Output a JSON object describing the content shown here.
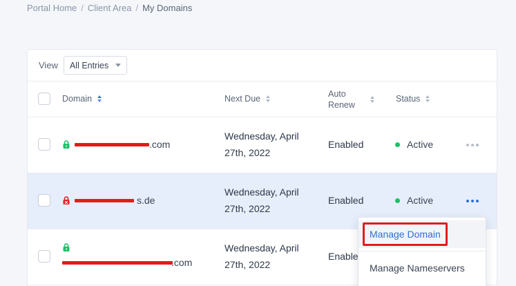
{
  "breadcrumb": {
    "items": [
      "Portal Home",
      "Client Area",
      "My Domains"
    ],
    "separator": "/"
  },
  "toolbar": {
    "view_label": "View",
    "view_select_value": "All Entries"
  },
  "table": {
    "headers": {
      "domain": "Domain",
      "next_due": "Next Due",
      "auto_renew_line1": "Auto",
      "auto_renew_line2": "Renew",
      "status": "Status"
    },
    "rows": [
      {
        "domain_visible_suffix": ".com",
        "lock_color": "#1fbf67",
        "due_line1": "Wednesday, April",
        "due_line2": "27th, 2022",
        "auto_renew": "Enabled",
        "status": "Active"
      },
      {
        "domain_visible_suffix": "s.de",
        "lock_color": "#e31b1b",
        "due_line1": "Wednesday, April",
        "due_line2": "27th, 2022",
        "auto_renew": "Enabled",
        "status": "Active"
      },
      {
        "domain_visible_suffix": ".com",
        "lock_color": "#1fbf67",
        "due_line1": "Wednesday, April",
        "due_line2": "27th, 2022",
        "auto_renew": "Enabled"
      }
    ]
  },
  "dropdown": {
    "items": [
      "Manage Domain",
      "Manage Nameservers"
    ]
  },
  "colors": {
    "accent": "#2f6fd6",
    "active_status": "#1fbf67",
    "redaction": "#e31b1b",
    "row_highlight": "#e5eefa"
  }
}
